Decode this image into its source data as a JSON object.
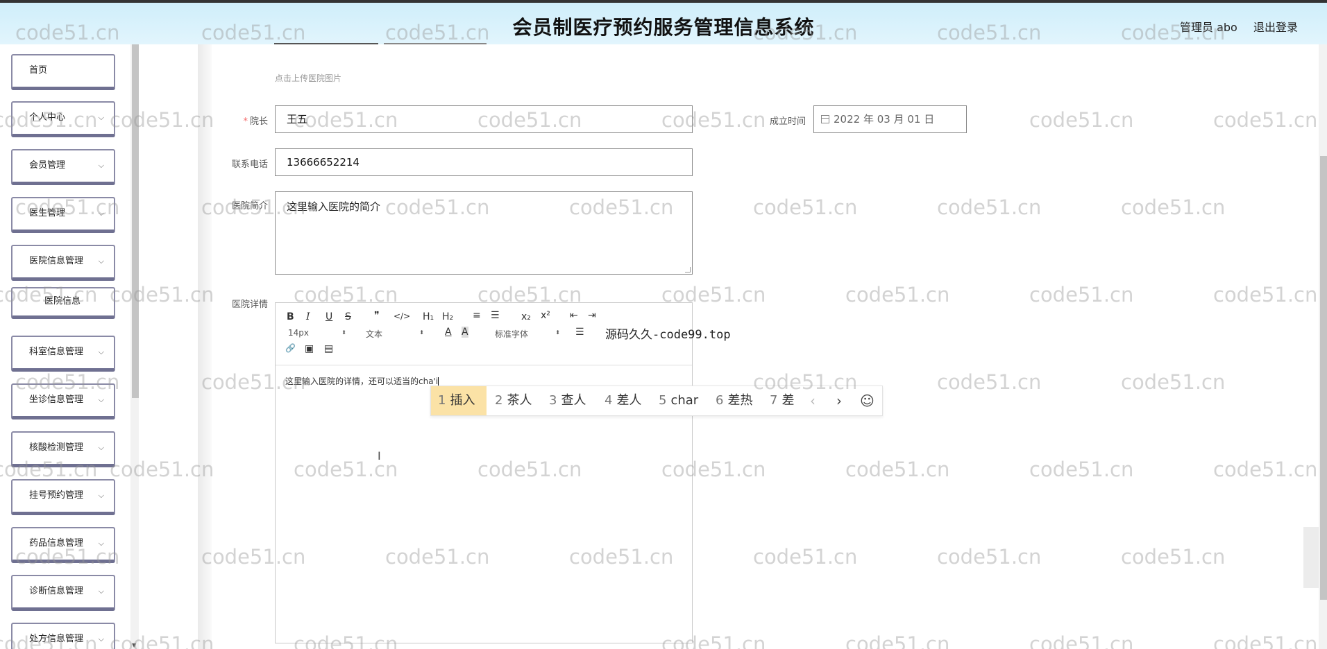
{
  "header": {
    "title": "会员制医疗预约服务管理信息系统",
    "admin_label": "管理员 abo",
    "logout_label": "退出登录"
  },
  "sidebar": {
    "items": [
      {
        "label": "首页",
        "has_chevron": false
      },
      {
        "label": "个人中心",
        "has_chevron": true
      },
      {
        "label": "会员管理",
        "has_chevron": true
      },
      {
        "label": "医生管理",
        "has_chevron": true
      },
      {
        "label": "医院信息管理",
        "has_chevron": true
      },
      {
        "label": "医院信息",
        "has_chevron": false,
        "sub": true
      },
      {
        "label": "科室信息管理",
        "has_chevron": true
      },
      {
        "label": "坐诊信息管理",
        "has_chevron": true
      },
      {
        "label": "核酸检测管理",
        "has_chevron": true
      },
      {
        "label": "挂号预约管理",
        "has_chevron": true
      },
      {
        "label": "药品信息管理",
        "has_chevron": true
      },
      {
        "label": "诊断信息管理",
        "has_chevron": true
      },
      {
        "label": "处方信息管理",
        "has_chevron": true
      }
    ],
    "chevron_icon": "chevron-down-icon"
  },
  "form": {
    "upload_hint": "点击上传医院图片",
    "director": {
      "label": "院长",
      "value": "王五",
      "required": true
    },
    "founded": {
      "label": "成立时间",
      "value": "2022 年 03 月 01 日"
    },
    "phone": {
      "label": "联系电话",
      "value": "13666652214"
    },
    "intro": {
      "label": "医院简介",
      "value": "这里输入医院的简介"
    },
    "details": {
      "label": "医院详情",
      "content": "这里输入医院的详情，还可以适当的cha'i",
      "toolbar": {
        "bold": "B",
        "italic": "I",
        "underline": "U",
        "strike": "S",
        "quote": "❞",
        "code": "</>",
        "h1": "H₁",
        "h2": "H₂",
        "ordered_list": "≡",
        "bullet_list": "☰",
        "sub": "x₂",
        "sup": "x²",
        "outdent": "⇤",
        "indent": "⇥",
        "size_select": "14px",
        "type_select": "文本",
        "font_select": "标准字体",
        "color": "A",
        "bg_color": "A",
        "align": "☰",
        "link": "🔗",
        "image": "▣",
        "video": "▤"
      }
    }
  },
  "overlay_text": "源码久久-code99.top",
  "ime": {
    "candidates": [
      {
        "num": "1",
        "text": "插入",
        "active": true
      },
      {
        "num": "2",
        "text": "茶人",
        "active": false
      },
      {
        "num": "3",
        "text": "查人",
        "active": false
      },
      {
        "num": "4",
        "text": "差人",
        "active": false
      },
      {
        "num": "5",
        "text": "char",
        "active": false
      },
      {
        "num": "6",
        "text": "差热",
        "active": false
      },
      {
        "num": "7",
        "text": "差",
        "active": false
      }
    ],
    "prev": "‹",
    "next": "›",
    "emoji": "☺"
  },
  "watermark": "code51.cn",
  "colors": {
    "header_bg": "#d6f0fb",
    "ime_active": "#fbe2a6",
    "required": "#f56c6c",
    "sidebar_border": "#6f7091"
  }
}
